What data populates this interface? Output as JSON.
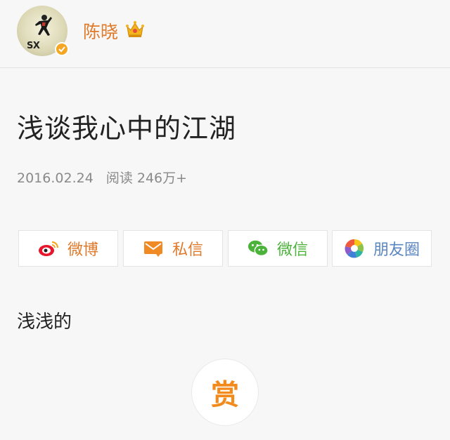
{
  "author": {
    "name": "陈晓",
    "avatar_text": "SX",
    "avatar_icon": "silhouette-figure",
    "verified_icon": "verified-check-icon",
    "crown_icon": "crown-icon"
  },
  "article": {
    "title": "浅谈我心中的江湖",
    "date": "2016.02.24",
    "reads": "阅读 246万+",
    "body": "浅浅的"
  },
  "share": {
    "weibo": {
      "label": "微博",
      "icon": "weibo-icon"
    },
    "message": {
      "label": "私信",
      "icon": "message-icon"
    },
    "wechat": {
      "label": "微信",
      "icon": "wechat-icon"
    },
    "moments": {
      "label": "朋友圈",
      "icon": "moments-icon"
    }
  },
  "reward": {
    "label": "赏"
  },
  "colors": {
    "accent_orange": "#e07a2b",
    "wechat_green": "#4cb33a",
    "moments_blue": "#5a86c2",
    "reward_orange": "#f28a1c"
  }
}
